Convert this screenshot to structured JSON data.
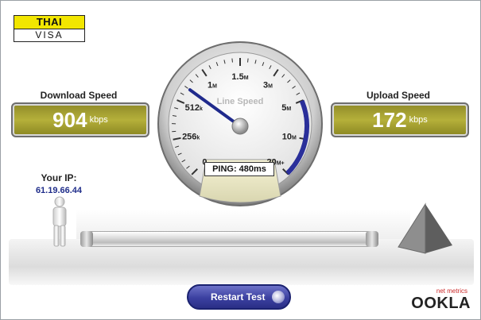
{
  "logo": {
    "top_text": "THAI",
    "bottom_text": "VISA"
  },
  "download": {
    "title": "Download Speed",
    "value": "904",
    "unit": "kbps"
  },
  "upload": {
    "title": "Upload Speed",
    "value": "172",
    "unit": "kbps"
  },
  "client": {
    "ip_label": "Your IP:",
    "ip_value": "61.19.66.44"
  },
  "gauge": {
    "label": "Line Speed",
    "ticks": [
      {
        "num": "0",
        "suffix": ""
      },
      {
        "num": "256",
        "suffix": "k"
      },
      {
        "num": "512",
        "suffix": "k"
      },
      {
        "num": "1",
        "suffix": "M"
      },
      {
        "num": "1.5",
        "suffix": "M"
      },
      {
        "num": "3",
        "suffix": "M"
      },
      {
        "num": "5",
        "suffix": "M"
      },
      {
        "num": "10",
        "suffix": "M"
      },
      {
        "num": "20",
        "suffix": "M+"
      }
    ],
    "needle_level": 0.3,
    "ping_text": "PING: 480ms"
  },
  "actions": {
    "restart_label": "Restart Test"
  },
  "brand": {
    "tagline": "net metrics",
    "name": "OOKLA"
  },
  "colors": {
    "readout": "#aba637",
    "accent": "#2a2f86",
    "brand_red": "#cc2a2a"
  }
}
